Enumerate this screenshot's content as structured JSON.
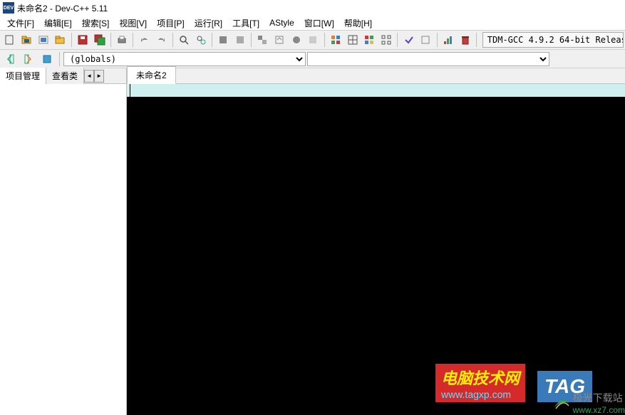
{
  "title": "未命名2 - Dev-C++ 5.11",
  "app_icon_text": "DEV",
  "menu": {
    "file": "文件[F]",
    "edit": "编辑[E]",
    "search": "搜索[S]",
    "view": "视图[V]",
    "project": "项目[P]",
    "run": "运行[R]",
    "tools": "工具[T]",
    "astyle": "AStyle",
    "window": "窗口[W]",
    "help": "帮助[H]"
  },
  "toolbar2": {
    "scope_combo": "(globals)",
    "member_combo": ""
  },
  "compiler_label": "TDM-GCC 4.9.2 64-bit Releas",
  "sidebar": {
    "tab1": "项目管理",
    "tab2": "查看类"
  },
  "file_tab": "未命名2",
  "watermarks": {
    "wm1_top": "电脑技术网",
    "wm1_bot": "www.tagxp.com",
    "wm2": "TAG",
    "wm3_txt1": "极光下载站",
    "wm3_txt2": "www.xz7.com"
  }
}
